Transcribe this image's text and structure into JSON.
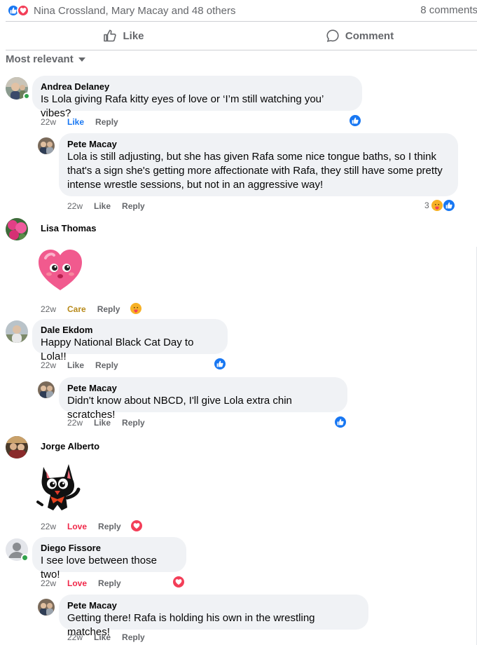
{
  "summary": {
    "names": "Nina Crossland, Mary Macay and 48 others",
    "comments": "8 comments"
  },
  "actions": {
    "like": "Like",
    "comment": "Comment"
  },
  "sort": {
    "label": "Most relevant"
  },
  "colors": {
    "like_blue": "#1877f2",
    "love_red": "#f33e58",
    "care_gold": "#f7b125",
    "bubble_bg": "#f0f2f5",
    "muted": "#65676b"
  },
  "comments": [
    {
      "author": "Andrea Delaney",
      "text": "Is Lola giving Rafa kitty eyes of love or ‘I’m still watching you’ vibes?",
      "time": "22w",
      "reaction_label": "Like",
      "reply_label": "Reply",
      "reaction_icon": "like-icon"
    },
    {
      "author": "Pete Macay",
      "text": "Lola is still adjusting, but she has given Rafa some nice tongue baths, so I think that's a sign she's getting more affectionate with Rafa, they still have some pretty intense wrestle sessions, but not in an aggressive way!",
      "time": "22w",
      "reaction_label": "Like",
      "reply_label": "Reply",
      "reaction_count": "3",
      "reaction_icons": [
        "care-icon",
        "like-icon"
      ]
    },
    {
      "author": "Lisa Thomas",
      "sticker": "pink-heart-sticker",
      "time": "22w",
      "reaction_label": "Care",
      "reply_label": "Reply",
      "reaction_icon": "care-icon"
    },
    {
      "author": "Dale Ekdom",
      "text": "Happy National Black Cat Day to Lola!!",
      "time": "22w",
      "reaction_label": "Like",
      "reply_label": "Reply",
      "reaction_icon": "like-icon"
    },
    {
      "author": "Pete Macay",
      "text": "Didn't know about NBCD, I'll give Lola extra chin scratches!",
      "time": "22w",
      "reaction_label": "Like",
      "reply_label": "Reply",
      "reaction_icon": "like-icon"
    },
    {
      "author": "Jorge Alberto",
      "sticker": "black-cat-sticker",
      "time": "22w",
      "reaction_label": "Love",
      "reply_label": "Reply",
      "reaction_icon": "love-icon"
    },
    {
      "author": "Diego Fissore",
      "text": "I see love between those two!",
      "time": "22w",
      "reaction_label": "Love",
      "reply_label": "Reply",
      "reaction_icon": "love-icon"
    },
    {
      "author": "Pete Macay",
      "text": "Getting there! Rafa is holding his own in the wrestling matches!",
      "time": "22w",
      "reaction_label": "Like",
      "reply_label": "Reply"
    }
  ]
}
